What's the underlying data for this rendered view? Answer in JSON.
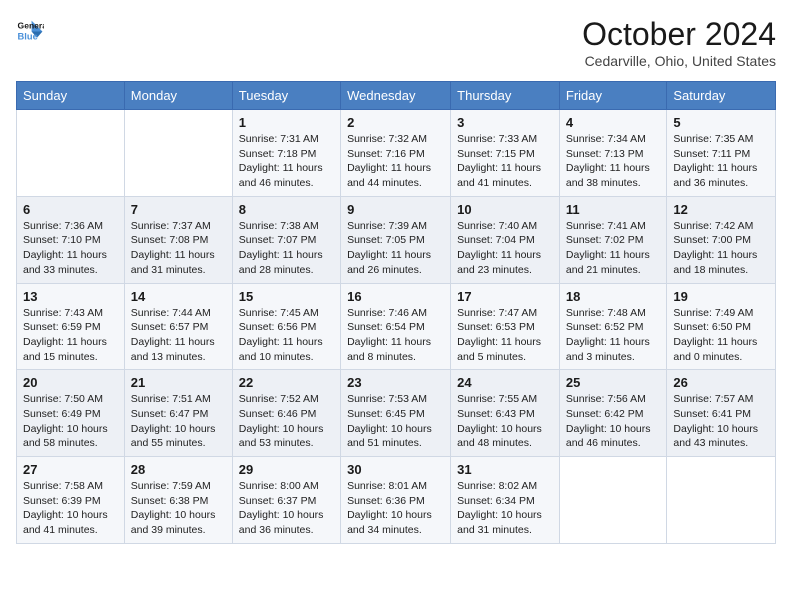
{
  "header": {
    "logo_line1": "General",
    "logo_line2": "Blue",
    "month_title": "October 2024",
    "location": "Cedarville, Ohio, United States"
  },
  "weekdays": [
    "Sunday",
    "Monday",
    "Tuesday",
    "Wednesday",
    "Thursday",
    "Friday",
    "Saturday"
  ],
  "weeks": [
    [
      {
        "day": "",
        "sunrise": "",
        "sunset": "",
        "daylight": ""
      },
      {
        "day": "",
        "sunrise": "",
        "sunset": "",
        "daylight": ""
      },
      {
        "day": "1",
        "sunrise": "Sunrise: 7:31 AM",
        "sunset": "Sunset: 7:18 PM",
        "daylight": "Daylight: 11 hours and 46 minutes."
      },
      {
        "day": "2",
        "sunrise": "Sunrise: 7:32 AM",
        "sunset": "Sunset: 7:16 PM",
        "daylight": "Daylight: 11 hours and 44 minutes."
      },
      {
        "day": "3",
        "sunrise": "Sunrise: 7:33 AM",
        "sunset": "Sunset: 7:15 PM",
        "daylight": "Daylight: 11 hours and 41 minutes."
      },
      {
        "day": "4",
        "sunrise": "Sunrise: 7:34 AM",
        "sunset": "Sunset: 7:13 PM",
        "daylight": "Daylight: 11 hours and 38 minutes."
      },
      {
        "day": "5",
        "sunrise": "Sunrise: 7:35 AM",
        "sunset": "Sunset: 7:11 PM",
        "daylight": "Daylight: 11 hours and 36 minutes."
      }
    ],
    [
      {
        "day": "6",
        "sunrise": "Sunrise: 7:36 AM",
        "sunset": "Sunset: 7:10 PM",
        "daylight": "Daylight: 11 hours and 33 minutes."
      },
      {
        "day": "7",
        "sunrise": "Sunrise: 7:37 AM",
        "sunset": "Sunset: 7:08 PM",
        "daylight": "Daylight: 11 hours and 31 minutes."
      },
      {
        "day": "8",
        "sunrise": "Sunrise: 7:38 AM",
        "sunset": "Sunset: 7:07 PM",
        "daylight": "Daylight: 11 hours and 28 minutes."
      },
      {
        "day": "9",
        "sunrise": "Sunrise: 7:39 AM",
        "sunset": "Sunset: 7:05 PM",
        "daylight": "Daylight: 11 hours and 26 minutes."
      },
      {
        "day": "10",
        "sunrise": "Sunrise: 7:40 AM",
        "sunset": "Sunset: 7:04 PM",
        "daylight": "Daylight: 11 hours and 23 minutes."
      },
      {
        "day": "11",
        "sunrise": "Sunrise: 7:41 AM",
        "sunset": "Sunset: 7:02 PM",
        "daylight": "Daylight: 11 hours and 21 minutes."
      },
      {
        "day": "12",
        "sunrise": "Sunrise: 7:42 AM",
        "sunset": "Sunset: 7:00 PM",
        "daylight": "Daylight: 11 hours and 18 minutes."
      }
    ],
    [
      {
        "day": "13",
        "sunrise": "Sunrise: 7:43 AM",
        "sunset": "Sunset: 6:59 PM",
        "daylight": "Daylight: 11 hours and 15 minutes."
      },
      {
        "day": "14",
        "sunrise": "Sunrise: 7:44 AM",
        "sunset": "Sunset: 6:57 PM",
        "daylight": "Daylight: 11 hours and 13 minutes."
      },
      {
        "day": "15",
        "sunrise": "Sunrise: 7:45 AM",
        "sunset": "Sunset: 6:56 PM",
        "daylight": "Daylight: 11 hours and 10 minutes."
      },
      {
        "day": "16",
        "sunrise": "Sunrise: 7:46 AM",
        "sunset": "Sunset: 6:54 PM",
        "daylight": "Daylight: 11 hours and 8 minutes."
      },
      {
        "day": "17",
        "sunrise": "Sunrise: 7:47 AM",
        "sunset": "Sunset: 6:53 PM",
        "daylight": "Daylight: 11 hours and 5 minutes."
      },
      {
        "day": "18",
        "sunrise": "Sunrise: 7:48 AM",
        "sunset": "Sunset: 6:52 PM",
        "daylight": "Daylight: 11 hours and 3 minutes."
      },
      {
        "day": "19",
        "sunrise": "Sunrise: 7:49 AM",
        "sunset": "Sunset: 6:50 PM",
        "daylight": "Daylight: 11 hours and 0 minutes."
      }
    ],
    [
      {
        "day": "20",
        "sunrise": "Sunrise: 7:50 AM",
        "sunset": "Sunset: 6:49 PM",
        "daylight": "Daylight: 10 hours and 58 minutes."
      },
      {
        "day": "21",
        "sunrise": "Sunrise: 7:51 AM",
        "sunset": "Sunset: 6:47 PM",
        "daylight": "Daylight: 10 hours and 55 minutes."
      },
      {
        "day": "22",
        "sunrise": "Sunrise: 7:52 AM",
        "sunset": "Sunset: 6:46 PM",
        "daylight": "Daylight: 10 hours and 53 minutes."
      },
      {
        "day": "23",
        "sunrise": "Sunrise: 7:53 AM",
        "sunset": "Sunset: 6:45 PM",
        "daylight": "Daylight: 10 hours and 51 minutes."
      },
      {
        "day": "24",
        "sunrise": "Sunrise: 7:55 AM",
        "sunset": "Sunset: 6:43 PM",
        "daylight": "Daylight: 10 hours and 48 minutes."
      },
      {
        "day": "25",
        "sunrise": "Sunrise: 7:56 AM",
        "sunset": "Sunset: 6:42 PM",
        "daylight": "Daylight: 10 hours and 46 minutes."
      },
      {
        "day": "26",
        "sunrise": "Sunrise: 7:57 AM",
        "sunset": "Sunset: 6:41 PM",
        "daylight": "Daylight: 10 hours and 43 minutes."
      }
    ],
    [
      {
        "day": "27",
        "sunrise": "Sunrise: 7:58 AM",
        "sunset": "Sunset: 6:39 PM",
        "daylight": "Daylight: 10 hours and 41 minutes."
      },
      {
        "day": "28",
        "sunrise": "Sunrise: 7:59 AM",
        "sunset": "Sunset: 6:38 PM",
        "daylight": "Daylight: 10 hours and 39 minutes."
      },
      {
        "day": "29",
        "sunrise": "Sunrise: 8:00 AM",
        "sunset": "Sunset: 6:37 PM",
        "daylight": "Daylight: 10 hours and 36 minutes."
      },
      {
        "day": "30",
        "sunrise": "Sunrise: 8:01 AM",
        "sunset": "Sunset: 6:36 PM",
        "daylight": "Daylight: 10 hours and 34 minutes."
      },
      {
        "day": "31",
        "sunrise": "Sunrise: 8:02 AM",
        "sunset": "Sunset: 6:34 PM",
        "daylight": "Daylight: 10 hours and 31 minutes."
      },
      {
        "day": "",
        "sunrise": "",
        "sunset": "",
        "daylight": ""
      },
      {
        "day": "",
        "sunrise": "",
        "sunset": "",
        "daylight": ""
      }
    ]
  ]
}
